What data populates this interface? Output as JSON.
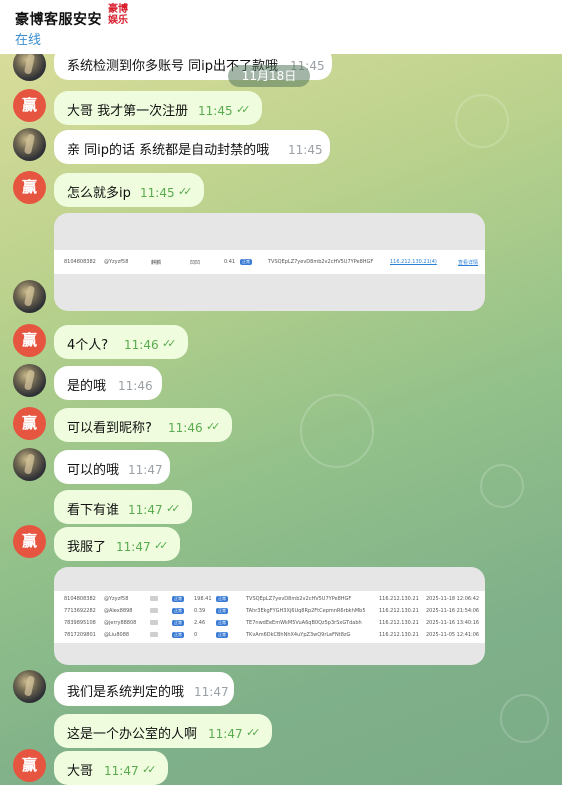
{
  "header": {
    "title": "豪博客服安安",
    "brand": "豪博娱乐",
    "status": "在线"
  },
  "date_separator": "11月18日",
  "messages": [
    {
      "text": "系统检测到你多账号  同ip出不了款哦",
      "time": "11:45"
    },
    {
      "text": "大哥 我才第一次注册",
      "time": "11:45",
      "read": "✓✓"
    },
    {
      "text": "亲  同ip的话  系统都是自动封禁的哦",
      "time": "11:45"
    },
    {
      "text": "怎么就多ip",
      "time": "11:45",
      "read": "✓✓"
    },
    {
      "text": "4个人?",
      "time": "11:46",
      "read": "✓✓"
    },
    {
      "text": "是的哦",
      "time": "11:46"
    },
    {
      "text": "可以看到昵称?",
      "time": "11:46",
      "read": "✓✓"
    },
    {
      "text": "可以的哦",
      "time": "11:47"
    },
    {
      "text": "看下有谁",
      "time": "11:47",
      "read": "✓✓"
    },
    {
      "text": "我服了",
      "time": "11:47",
      "read": "✓✓"
    },
    {
      "text": "我们是系统判定的哦",
      "time": "11:47"
    },
    {
      "text": "这是一个办公室的人啊",
      "time": "11:47",
      "read": "✓✓"
    },
    {
      "text": "大哥",
      "time": "11:47",
      "read": "✓✓"
    }
  ],
  "avatar_red_char": "赢",
  "image1": {
    "row": [
      "8104808382",
      "@Yzyzf58",
      "麒麟",
      "凹凹",
      "0.41",
      "正常",
      "TVSQEpLZ7yevD8mb2v2cHV5U7YPe8HGF",
      "116.212.130.21(4)",
      "查看详情"
    ]
  },
  "image2": {
    "rows": [
      [
        "8104808382",
        "@Yzyzf58",
        "麒麟",
        "正常",
        "198.41",
        "正常",
        "TVSQEpLZ7yevD8mb2v2cHV5U7YPe8HGF",
        "116.212.130.21",
        "2025-11-18 12:06:42"
      ],
      [
        "7713692282",
        "@Alex8898",
        "麒麟",
        "正常",
        "0.39",
        "正常",
        "TAhr3EkgFYGH3Xj6Uq8Rp2FtCepmnR6rbkhMb5",
        "116.212.130.21",
        "2025-11-16 21:54:06"
      ],
      [
        "7839895108",
        "@jerry88808",
        "麒麟",
        "正常",
        "2.46",
        "正常",
        "TE7nwdEeEmWkM5VuA6qB0Qz5p3rSxGTdabh",
        "116.212.130.21",
        "2025-11-16 13:40:16"
      ],
      [
        "7817209801",
        "@Liu8088",
        "麒麟",
        "正常",
        "0",
        "正常",
        "TKvAm6DkCBhNhX4uYpZ3wQ9rLeFNt8zG",
        "116.212.130.21",
        "2025-11-05 12:41:06"
      ]
    ]
  },
  "colors": {
    "accent": "#3b8ed0",
    "outgoing_bubble": "#effdde",
    "read_check": "#5aab4f",
    "avatar_red": "#e5553f",
    "brand_red": "#d8202f"
  }
}
